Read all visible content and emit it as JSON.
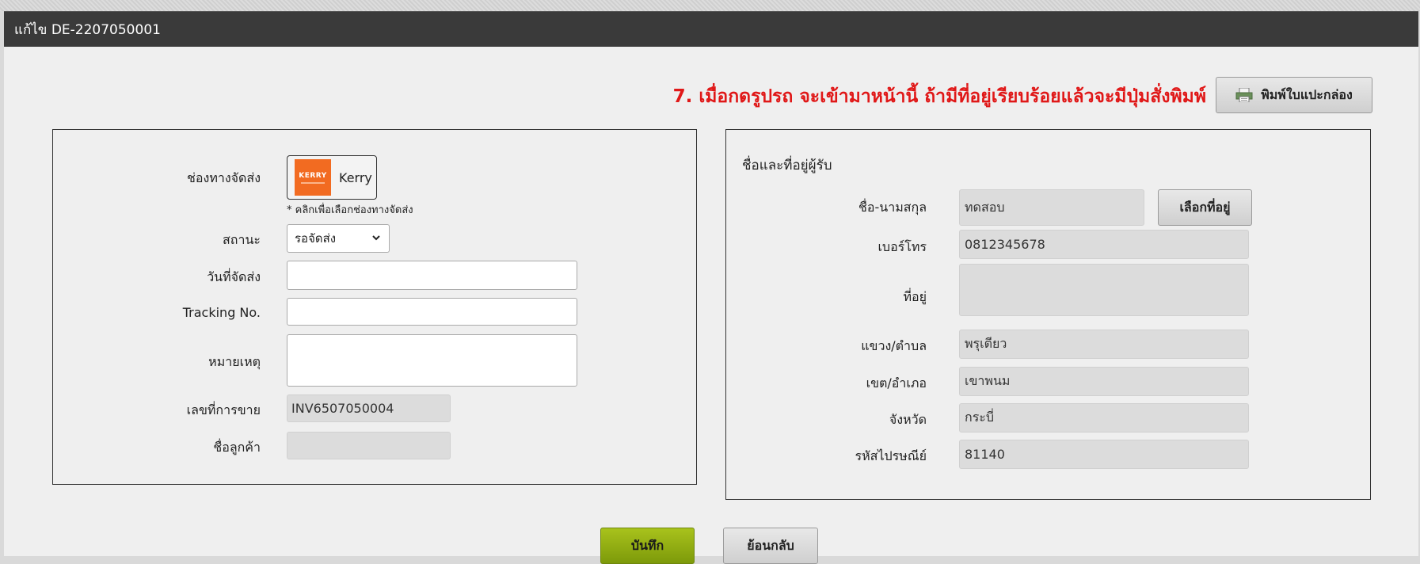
{
  "window": {
    "title": "แก้ไข DE-2207050001"
  },
  "note": "7. เมื่อกดรูปรถ จะเข้ามาหน้านี้ ถ้ามีที่อยู่เรียบร้อยแล้วจะมีปุ่มสั่งพิมพ์",
  "print_button": {
    "label": "พิมพ์ใบแปะกล่อง",
    "icon": "printer-icon"
  },
  "shipping": {
    "channel_label": "ช่องทางจัดส่ง",
    "channel_value": "Kerry",
    "channel_logo_text": "KERRY",
    "channel_hint": "* คลิกเพื่อเลือกช่องทางจัดส่ง",
    "status_label": "สถานะ",
    "status_value": "รอจัดส่ง",
    "ship_date_label": "วันที่จัดส่ง",
    "ship_date_value": "",
    "tracking_label": "Tracking No.",
    "tracking_value": "",
    "remark_label": "หมายเหตุ",
    "remark_value": "",
    "invoice_label": "เลขที่การขาย",
    "invoice_value": "INV6507050004",
    "customer_label": "ชื่อลูกค้า",
    "customer_value": ""
  },
  "recipient": {
    "section_title": "ชื่อและที่อยู่ผู้รับ",
    "name_label": "ชื่อ-นามสกุล",
    "name_value": "ทดสอบ",
    "choose_address_button": "เลือกที่อยู่",
    "phone_label": "เบอร์โทร",
    "phone_value": "0812345678",
    "address_label": "ที่อยู่",
    "address_value": "",
    "subdistrict_label": "แขวง/ตำบล",
    "subdistrict_value": "พรุเตียว",
    "district_label": "เขต/อำเภอ",
    "district_value": "เขาพนม",
    "province_label": "จังหวัด",
    "province_value": "กระบี่",
    "postcode_label": "รหัสไปรษณีย์",
    "postcode_value": "81140"
  },
  "actions": {
    "save_label": "บันทึก",
    "back_label": "ย้อนกลับ"
  },
  "colors": {
    "titlebar": "#3a3a3a",
    "note": "#e01818",
    "save": "#8fae12",
    "kerry": "#f26b21"
  }
}
